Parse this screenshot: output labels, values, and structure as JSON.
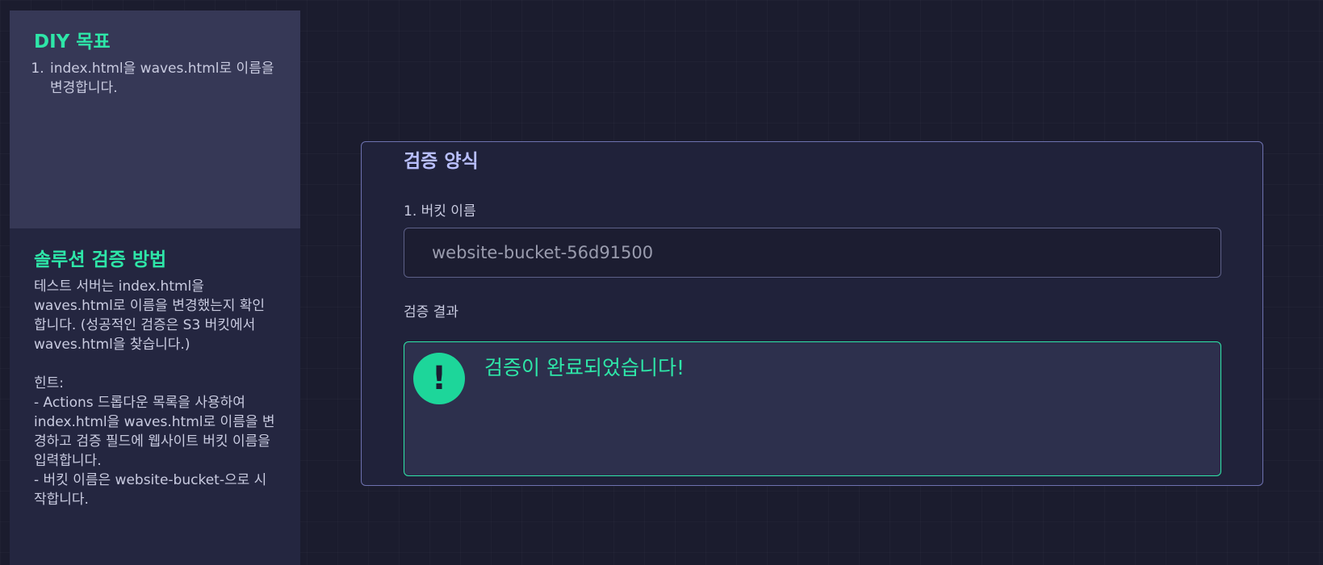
{
  "sidebar": {
    "goal": {
      "heading": "DIY 목표",
      "items": [
        "index.html을 waves.html로 이름을 변경합니다."
      ]
    },
    "verification": {
      "heading": "솔루션 검증 방법",
      "description": "테스트 서버는 index.html을 waves.html로 이름을 변경했는지 확인합니다. (성공적인 검증은 S3 버킷에서 waves.html을 찾습니다.)",
      "hint_title": "힌트:",
      "hints": [
        "- Actions 드롭다운 목록을 사용하여 index.html을 waves.html로 이름을 변경하고 검증 필드에 웹사이트 버킷 이름을 입력합니다.",
        "- 버킷 이름은 website-bucket-으로 시작합니다."
      ]
    }
  },
  "form": {
    "title": "검증 양식",
    "bucket_label": "1. 버킷 이름",
    "bucket_value": "website-bucket-56d91500",
    "result_label": "검증 결과",
    "result_icon": "exclamation-icon",
    "result_icon_glyph": "!",
    "result_message": "검증이 완료되었습니다!"
  },
  "colors": {
    "accent": "#2ee6a8",
    "background": "#1b1c2e",
    "panel_highlight": "#363856",
    "form_title": "#b9bfff",
    "card_border": "#6e72b0"
  }
}
